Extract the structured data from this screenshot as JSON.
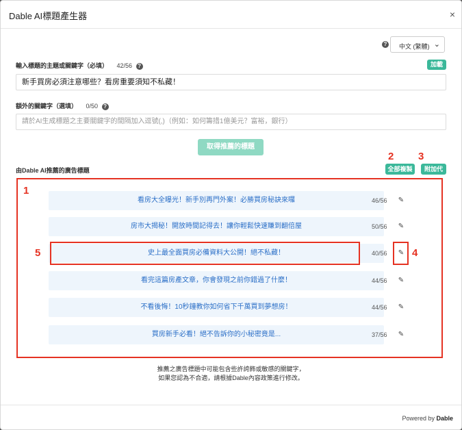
{
  "modal": {
    "title": "Dable AI標題產生器",
    "close": "×"
  },
  "language": {
    "selected": "中文 (繁體)"
  },
  "topic": {
    "label": "輸入標題的主題或關鍵字（必填）",
    "count": "42/56",
    "load_button": "加載",
    "value": "新手買房必須注意哪些？看房重要須知不私藏！"
  },
  "extra": {
    "label": "額外的關鍵字（選填）",
    "count": "0/50",
    "placeholder": "請於AI生成標題之主要關鍵字的間隔加入逗號(,)（例如：如何籌措1億美元？富裕，銀行）"
  },
  "fetch_button": "取得推薦的標題",
  "recommended": {
    "label": "由Dable AI推薦的廣告標題",
    "copy_all": "全部複製",
    "append": "附加代",
    "items": [
      {
        "title": "看房大全曝光！新手別再門外案！必勝買房秘訣來囉",
        "count": "46/56"
      },
      {
        "title": "房市大揭秘！開放時間記得去！讓你輕鬆快速賺到翻倍屋",
        "count": "50/56"
      },
      {
        "title": "史上最全面買房必備資料大公開！絕不私藏！",
        "count": "40/56"
      },
      {
        "title": "看完這篇房產文章，你會發現之前你錯過了什麼！",
        "count": "44/56"
      },
      {
        "title": "不看後悔！10秒鐘教你如何省下千萬買到夢想房！",
        "count": "44/56"
      },
      {
        "title": "買房新手必看！絕不告訴你的小秘密竟是...",
        "count": "37/56"
      }
    ]
  },
  "markers": [
    "1",
    "2",
    "3",
    "4",
    "5"
  ],
  "notice": {
    "line1": "推薦之廣告標題中可能包含些許誇飾或敏感的關鍵字，",
    "line2": "如果您認為不合適，請根據Dable內容政策進行修改。"
  },
  "footer": {
    "powered_prefix": "Powered by ",
    "brand": "Dable"
  },
  "colors": {
    "accent": "#3bb89a",
    "annotation": "#e53222",
    "link": "#2b6fc7"
  },
  "icons": {
    "help": "help-icon",
    "edit": "pencil-icon",
    "close": "close-icon",
    "dropdown": "chevron-down-icon"
  }
}
